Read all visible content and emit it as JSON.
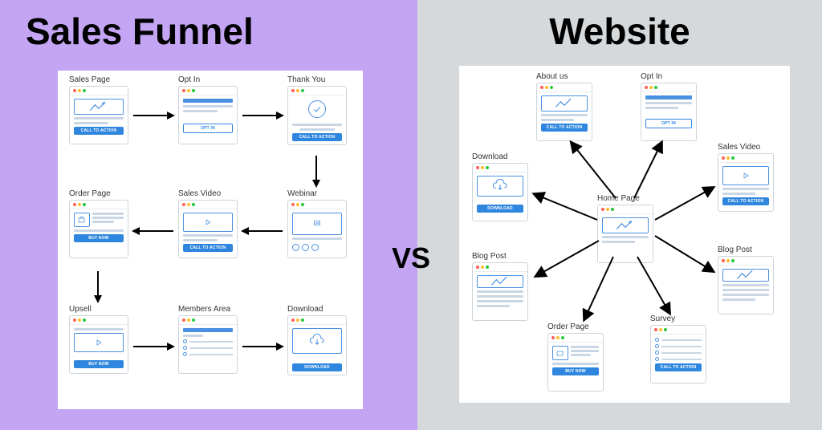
{
  "titles": {
    "left": "Sales Funnel",
    "right": "Website",
    "versus": "VS"
  },
  "funnel": {
    "cards": [
      {
        "label": "Sales Page",
        "btn": "CALL TO ACTION"
      },
      {
        "label": "Opt In",
        "btn": "OPT IN"
      },
      {
        "label": "Thank You",
        "btn": "CALL TO ACTION"
      },
      {
        "label": "Order Page",
        "btn": "BUY NOW"
      },
      {
        "label": "Sales Video",
        "btn": "CALL TO ACTION"
      },
      {
        "label": "Webinar",
        "btn": ""
      },
      {
        "label": "Upsell",
        "btn": "BUY NOW"
      },
      {
        "label": "Members Area",
        "btn": ""
      },
      {
        "label": "Download",
        "btn": "DOWNLOAD"
      }
    ]
  },
  "website": {
    "center": "Home Page",
    "cards": [
      {
        "label": "About us",
        "btn": "CALL TO ACTION"
      },
      {
        "label": "Opt In",
        "btn": "OPT IN"
      },
      {
        "label": "Download",
        "btn": "DOWNLOAD"
      },
      {
        "label": "Sales Video",
        "btn": "CALL TO ACTION"
      },
      {
        "label": "Blog Post",
        "btn": ""
      },
      {
        "label": "Blog Post",
        "btn": ""
      },
      {
        "label": "Order Page",
        "btn": "BUY NOW"
      },
      {
        "label": "Survey",
        "btn": "CALL TO ACTION"
      }
    ]
  }
}
